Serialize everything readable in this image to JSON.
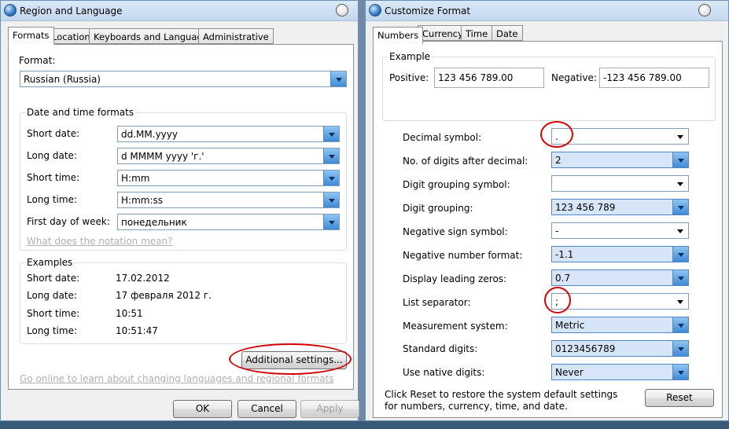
{
  "left_window": {
    "title": "Region and Language",
    "tabs": [
      "Formats",
      "Location",
      "Keyboards and Languages",
      "Administrative"
    ],
    "format_label": "Format:",
    "format_value": "Russian (Russia)",
    "datetime_group": "Date and time formats",
    "short_date_label": "Short date:",
    "short_date_value": "dd.MM.yyyy",
    "long_date_label": "Long date:",
    "long_date_value": "d MMMM yyyy 'г.'",
    "short_time_label": "Short time:",
    "short_time_value": "H:mm",
    "long_time_label": "Long time:",
    "long_time_value": "H:mm:ss",
    "first_day_label": "First day of week:",
    "first_day_value": "понедельник",
    "notation_link": "What does the notation mean?",
    "examples_group": "Examples",
    "ex_short_date_label": "Short date:",
    "ex_short_date_value": "17.02.2012",
    "ex_long_date_label": "Long date:",
    "ex_long_date_value": "17 февраля 2012 г.",
    "ex_short_time_label": "Short time:",
    "ex_short_time_value": "10:51",
    "ex_long_time_label": "Long time:",
    "ex_long_time_value": "10:51:47",
    "additional_settings": "Additional settings...",
    "online_link": "Go online to learn about changing languages and regional formats",
    "ok": "OK",
    "cancel": "Cancel",
    "apply": "Apply"
  },
  "right_window": {
    "title": "Customize Format",
    "tabs": [
      "Numbers",
      "Currency",
      "Time",
      "Date"
    ],
    "example_group": "Example",
    "positive_label": "Positive:",
    "positive_value": "123 456 789.00",
    "negative_label": "Negative:",
    "negative_value": "-123 456 789.00",
    "rows": [
      {
        "label": "Decimal symbol:",
        "value": "."
      },
      {
        "label": "No. of digits after decimal:",
        "value": "2"
      },
      {
        "label": "Digit grouping symbol:",
        "value": ""
      },
      {
        "label": "Digit grouping:",
        "value": "123 456 789"
      },
      {
        "label": "Negative sign symbol:",
        "value": "-"
      },
      {
        "label": "Negative number format:",
        "value": "-1.1"
      },
      {
        "label": "Display leading zeros:",
        "value": "0.7"
      },
      {
        "label": "List separator:",
        "value": ";"
      },
      {
        "label": "Measurement system:",
        "value": "Metric"
      },
      {
        "label": "Standard digits:",
        "value": "0123456789"
      },
      {
        "label": "Use native digits:",
        "value": "Never"
      }
    ],
    "reset_note": "Click Reset to restore the system default settings for numbers, currency, time, and date.",
    "reset": "Reset"
  },
  "colors": {
    "accent_ring": "#d60000",
    "combo_arrow": "#3f8ad6"
  }
}
